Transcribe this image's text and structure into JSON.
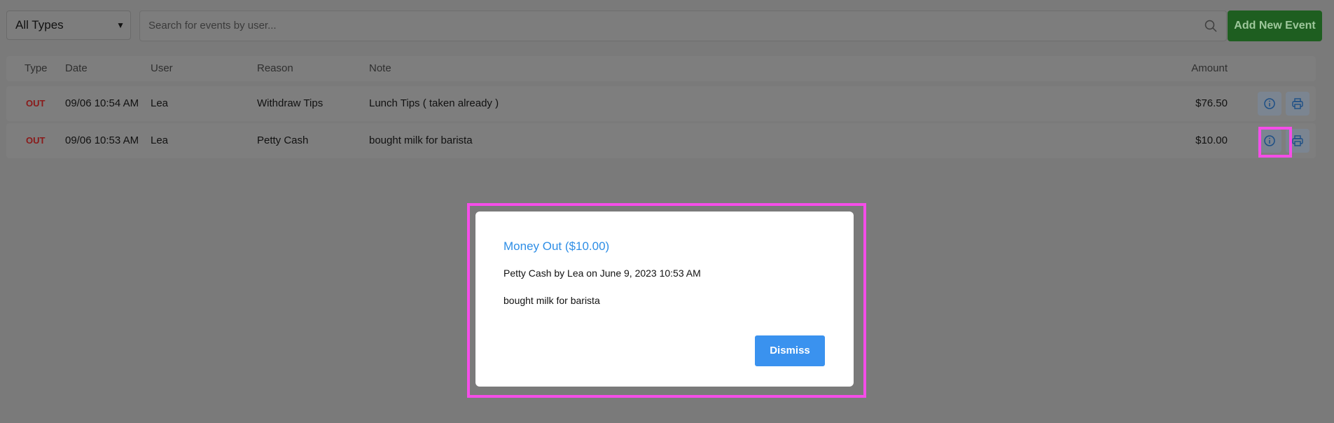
{
  "filter": {
    "selected": "All Types"
  },
  "search": {
    "placeholder": "Search for events by user..."
  },
  "toolbar": {
    "add_label": "Add New Event"
  },
  "table": {
    "headers": {
      "type": "Type",
      "date": "Date",
      "user": "User",
      "reason": "Reason",
      "note": "Note",
      "amount": "Amount"
    },
    "rows": [
      {
        "type": "OUT",
        "date": "09/06 10:54 AM",
        "user": "Lea",
        "reason": "Withdraw Tips",
        "note": "Lunch Tips ( taken already )",
        "amount": "$76.50"
      },
      {
        "type": "OUT",
        "date": "09/06 10:53 AM",
        "user": "Lea",
        "reason": "Petty Cash",
        "note": "bought milk for barista",
        "amount": "$10.00"
      }
    ]
  },
  "modal": {
    "title": "Money Out ($10.00)",
    "subtitle": "Petty Cash by Lea on June 9, 2023 10:53 AM",
    "note": "bought milk for barista",
    "dismiss_label": "Dismiss"
  },
  "colors": {
    "accent": "#2e8ee6",
    "add_button": "#1e5e20",
    "out": "#8a1a1a",
    "highlight": "#f54de8"
  }
}
